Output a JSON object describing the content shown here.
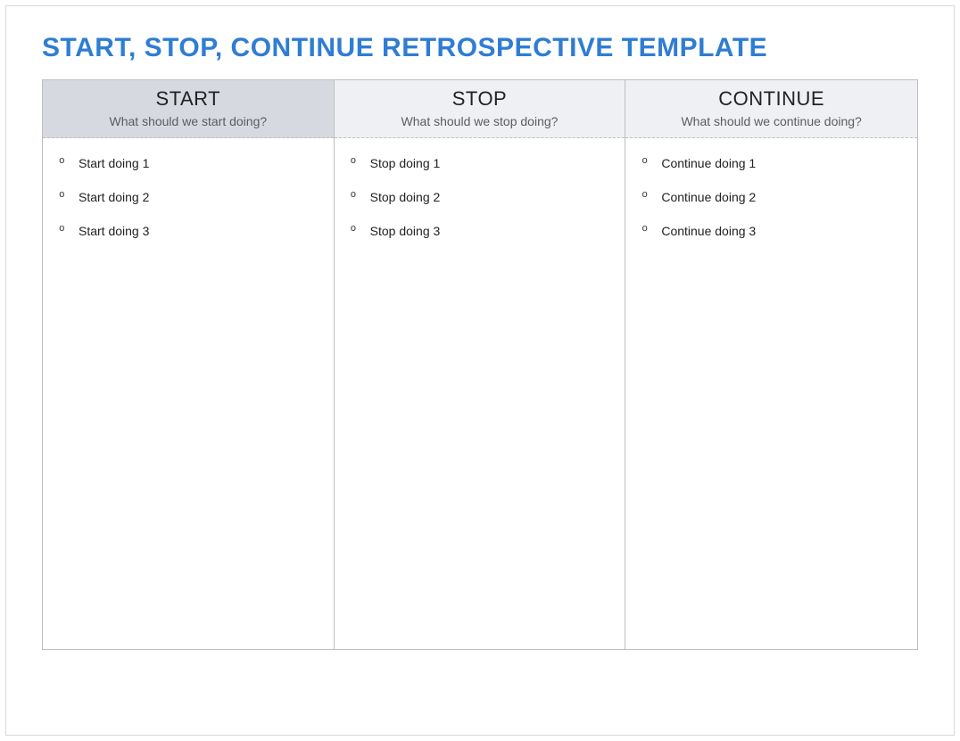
{
  "title": "START, STOP, CONTINUE RETROSPECTIVE TEMPLATE",
  "columns": [
    {
      "header": "START",
      "subheader": "What should we start doing?",
      "items": [
        "Start doing 1",
        "Start doing 2",
        "Start doing 3"
      ]
    },
    {
      "header": "STOP",
      "subheader": "What should we stop doing?",
      "items": [
        "Stop doing 1",
        "Stop doing 2",
        "Stop doing 3"
      ]
    },
    {
      "header": "CONTINUE",
      "subheader": "What should we continue doing?",
      "items": [
        "Continue doing 1",
        "Continue doing 2",
        "Continue doing 3"
      ]
    }
  ]
}
